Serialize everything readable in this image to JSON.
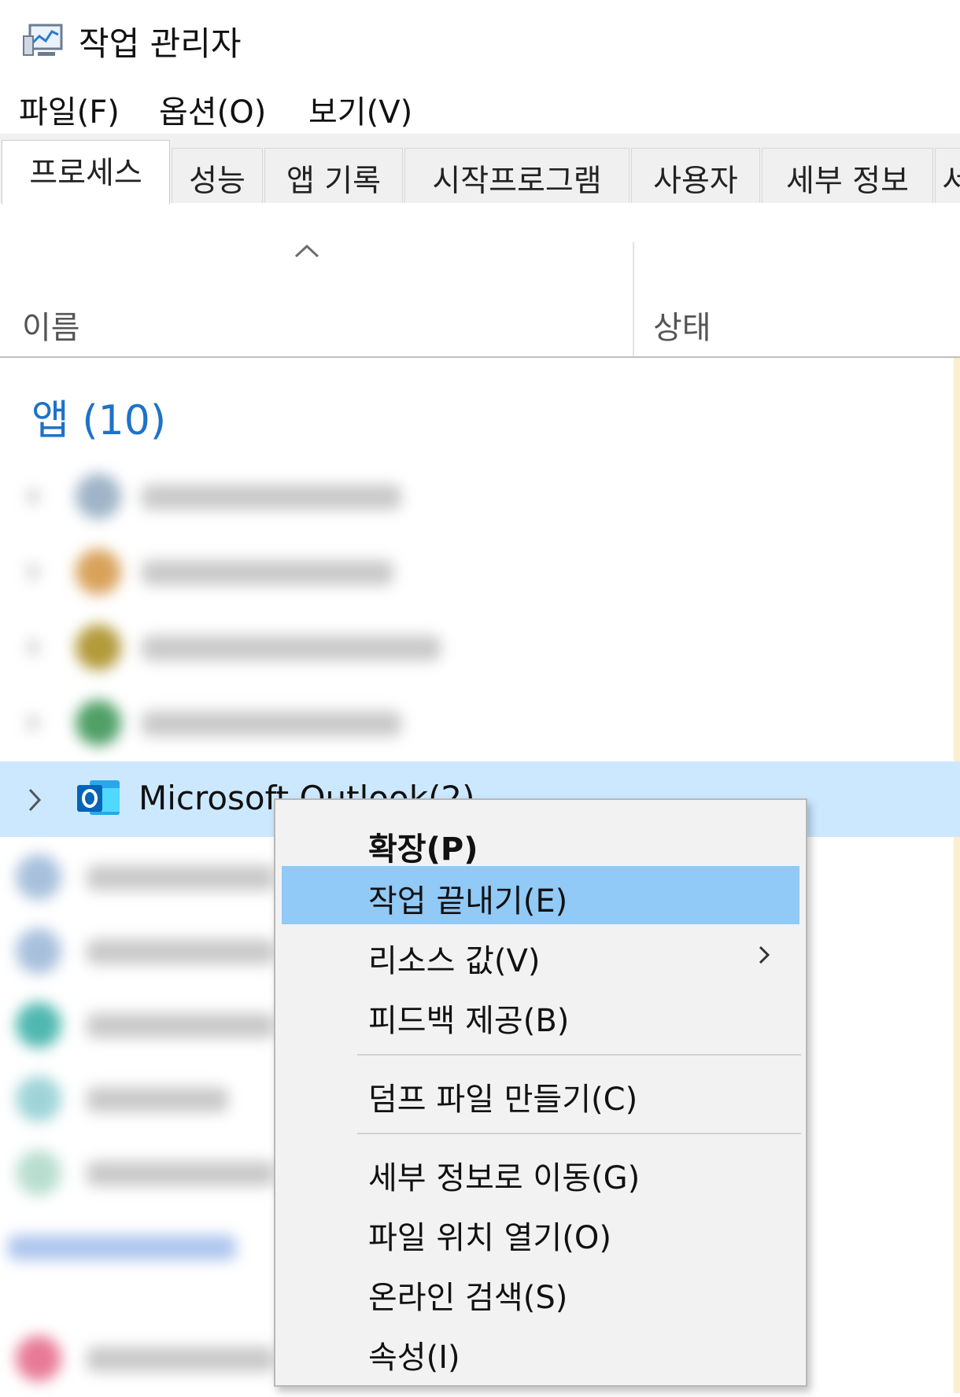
{
  "window": {
    "title": "작업 관리자",
    "icon": "task-manager-icon"
  },
  "menubar": {
    "items": [
      "파일(F)",
      "옵션(O)",
      "보기(V)"
    ]
  },
  "tabs": [
    {
      "label": "프로세스",
      "active": true
    },
    {
      "label": "성능"
    },
    {
      "label": "앱 기록"
    },
    {
      "label": "시작프로그램"
    },
    {
      "label": "사용자"
    },
    {
      "label": "세부 정보"
    },
    {
      "label": "서"
    }
  ],
  "table": {
    "columns": {
      "name": "이름",
      "status": "상태"
    },
    "group_title": "앱 (10)",
    "selected_row": {
      "label": "Microsoft Outlook(2)",
      "icon": "outlook-icon"
    }
  },
  "context_menu": {
    "items": [
      "확장(P)",
      "작업 끝내기(E)",
      "리소스 값(V)",
      "피드백 제공(B)",
      "덤프 파일 만들기(C)",
      "세부 정보로 이동(G)",
      "파일 위치 열기(O)",
      "온라인 검색(S)",
      "속성(I)"
    ],
    "highlighted": "작업 끝내기(E)"
  },
  "colors": {
    "accent": "#1e72c8",
    "selection": "#cce8ff",
    "menu_hover": "#91c9f7"
  }
}
